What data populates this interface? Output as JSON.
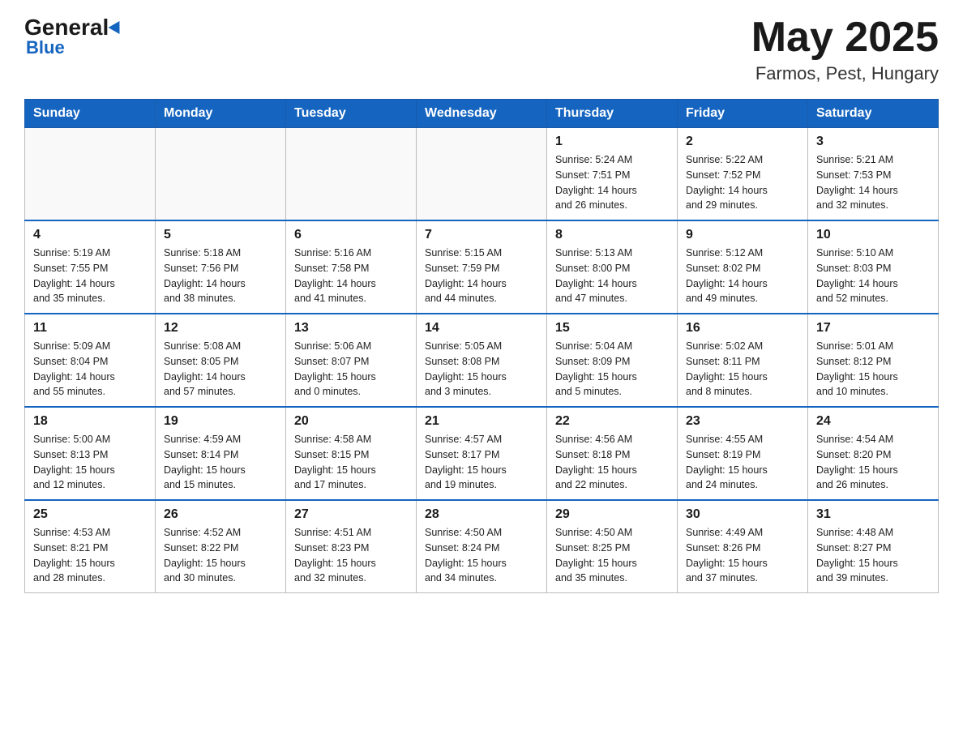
{
  "header": {
    "logo_general": "General",
    "logo_blue": "Blue",
    "month_title": "May 2025",
    "location": "Farmos, Pest, Hungary"
  },
  "days_of_week": [
    "Sunday",
    "Monday",
    "Tuesday",
    "Wednesday",
    "Thursday",
    "Friday",
    "Saturday"
  ],
  "weeks": [
    [
      {
        "day": "",
        "info": ""
      },
      {
        "day": "",
        "info": ""
      },
      {
        "day": "",
        "info": ""
      },
      {
        "day": "",
        "info": ""
      },
      {
        "day": "1",
        "info": "Sunrise: 5:24 AM\nSunset: 7:51 PM\nDaylight: 14 hours\nand 26 minutes."
      },
      {
        "day": "2",
        "info": "Sunrise: 5:22 AM\nSunset: 7:52 PM\nDaylight: 14 hours\nand 29 minutes."
      },
      {
        "day": "3",
        "info": "Sunrise: 5:21 AM\nSunset: 7:53 PM\nDaylight: 14 hours\nand 32 minutes."
      }
    ],
    [
      {
        "day": "4",
        "info": "Sunrise: 5:19 AM\nSunset: 7:55 PM\nDaylight: 14 hours\nand 35 minutes."
      },
      {
        "day": "5",
        "info": "Sunrise: 5:18 AM\nSunset: 7:56 PM\nDaylight: 14 hours\nand 38 minutes."
      },
      {
        "day": "6",
        "info": "Sunrise: 5:16 AM\nSunset: 7:58 PM\nDaylight: 14 hours\nand 41 minutes."
      },
      {
        "day": "7",
        "info": "Sunrise: 5:15 AM\nSunset: 7:59 PM\nDaylight: 14 hours\nand 44 minutes."
      },
      {
        "day": "8",
        "info": "Sunrise: 5:13 AM\nSunset: 8:00 PM\nDaylight: 14 hours\nand 47 minutes."
      },
      {
        "day": "9",
        "info": "Sunrise: 5:12 AM\nSunset: 8:02 PM\nDaylight: 14 hours\nand 49 minutes."
      },
      {
        "day": "10",
        "info": "Sunrise: 5:10 AM\nSunset: 8:03 PM\nDaylight: 14 hours\nand 52 minutes."
      }
    ],
    [
      {
        "day": "11",
        "info": "Sunrise: 5:09 AM\nSunset: 8:04 PM\nDaylight: 14 hours\nand 55 minutes."
      },
      {
        "day": "12",
        "info": "Sunrise: 5:08 AM\nSunset: 8:05 PM\nDaylight: 14 hours\nand 57 minutes."
      },
      {
        "day": "13",
        "info": "Sunrise: 5:06 AM\nSunset: 8:07 PM\nDaylight: 15 hours\nand 0 minutes."
      },
      {
        "day": "14",
        "info": "Sunrise: 5:05 AM\nSunset: 8:08 PM\nDaylight: 15 hours\nand 3 minutes."
      },
      {
        "day": "15",
        "info": "Sunrise: 5:04 AM\nSunset: 8:09 PM\nDaylight: 15 hours\nand 5 minutes."
      },
      {
        "day": "16",
        "info": "Sunrise: 5:02 AM\nSunset: 8:11 PM\nDaylight: 15 hours\nand 8 minutes."
      },
      {
        "day": "17",
        "info": "Sunrise: 5:01 AM\nSunset: 8:12 PM\nDaylight: 15 hours\nand 10 minutes."
      }
    ],
    [
      {
        "day": "18",
        "info": "Sunrise: 5:00 AM\nSunset: 8:13 PM\nDaylight: 15 hours\nand 12 minutes."
      },
      {
        "day": "19",
        "info": "Sunrise: 4:59 AM\nSunset: 8:14 PM\nDaylight: 15 hours\nand 15 minutes."
      },
      {
        "day": "20",
        "info": "Sunrise: 4:58 AM\nSunset: 8:15 PM\nDaylight: 15 hours\nand 17 minutes."
      },
      {
        "day": "21",
        "info": "Sunrise: 4:57 AM\nSunset: 8:17 PM\nDaylight: 15 hours\nand 19 minutes."
      },
      {
        "day": "22",
        "info": "Sunrise: 4:56 AM\nSunset: 8:18 PM\nDaylight: 15 hours\nand 22 minutes."
      },
      {
        "day": "23",
        "info": "Sunrise: 4:55 AM\nSunset: 8:19 PM\nDaylight: 15 hours\nand 24 minutes."
      },
      {
        "day": "24",
        "info": "Sunrise: 4:54 AM\nSunset: 8:20 PM\nDaylight: 15 hours\nand 26 minutes."
      }
    ],
    [
      {
        "day": "25",
        "info": "Sunrise: 4:53 AM\nSunset: 8:21 PM\nDaylight: 15 hours\nand 28 minutes."
      },
      {
        "day": "26",
        "info": "Sunrise: 4:52 AM\nSunset: 8:22 PM\nDaylight: 15 hours\nand 30 minutes."
      },
      {
        "day": "27",
        "info": "Sunrise: 4:51 AM\nSunset: 8:23 PM\nDaylight: 15 hours\nand 32 minutes."
      },
      {
        "day": "28",
        "info": "Sunrise: 4:50 AM\nSunset: 8:24 PM\nDaylight: 15 hours\nand 34 minutes."
      },
      {
        "day": "29",
        "info": "Sunrise: 4:50 AM\nSunset: 8:25 PM\nDaylight: 15 hours\nand 35 minutes."
      },
      {
        "day": "30",
        "info": "Sunrise: 4:49 AM\nSunset: 8:26 PM\nDaylight: 15 hours\nand 37 minutes."
      },
      {
        "day": "31",
        "info": "Sunrise: 4:48 AM\nSunset: 8:27 PM\nDaylight: 15 hours\nand 39 minutes."
      }
    ]
  ]
}
